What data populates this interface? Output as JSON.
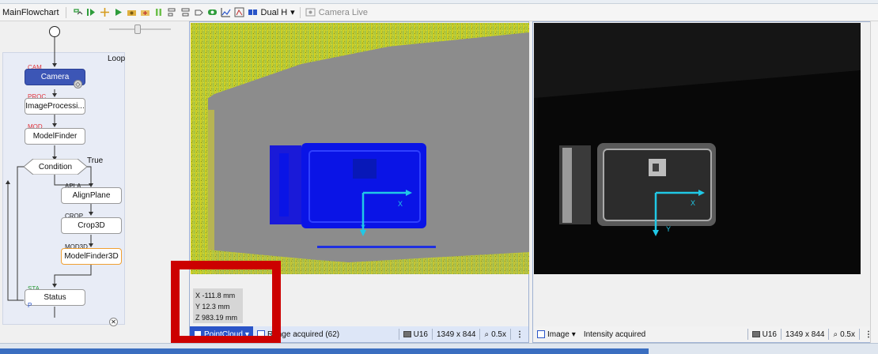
{
  "toolbar": {
    "title": "MainFlowchart",
    "dual_label": "Dual H",
    "camera_live_label": "Camera Live",
    "icons": [
      "step-icon",
      "run-icon",
      "play-icon",
      "camera-group-icon",
      "camera-add-icon",
      "pause-icon",
      "align-left-icon",
      "align-center-icon",
      "connect-icon",
      "record-icon",
      "chart-icon",
      "layout-icon",
      "grid-icon",
      "camera-live-icon"
    ]
  },
  "flowchart": {
    "loop_label": "Loop",
    "true_label": "True",
    "nodes": [
      {
        "tag": "CAM",
        "label": "Camera"
      },
      {
        "tag": "PROC",
        "label": "ImageProcessi..."
      },
      {
        "tag": "MOD",
        "label": "ModelFinder"
      },
      {
        "tag": "",
        "label": "Condition"
      },
      {
        "tag": "APLA",
        "label": "AlignPlane"
      },
      {
        "tag": "CROP",
        "label": "Crop3D"
      },
      {
        "tag": "MOD3D",
        "label": "ModelFinder3D"
      },
      {
        "tag": "STA",
        "label": "Status"
      }
    ],
    "status_port": "P"
  },
  "left_viewer": {
    "axis_x": "X",
    "axis_y": "Y",
    "coords": {
      "x": "X  -111.8 mm",
      "y": "Y  12.3 mm",
      "z": "Z  983.19 mm"
    },
    "status": {
      "mode_label": "PointCloud",
      "state_text": "Range acquired (62)",
      "format": "U16",
      "dims": "1349 x 844",
      "zoom": "0.5x",
      "more": "⋮"
    }
  },
  "right_viewer": {
    "axis_x": "X",
    "axis_y": "Y",
    "status": {
      "mode_label": "Image",
      "state_text": "Intensity acquired",
      "format": "U16",
      "dims": "1349 x 844",
      "zoom": "0.5x",
      "more": "⋮"
    }
  },
  "colors": {
    "selected_node": "#3c56b6",
    "highlight_frame": "#cc0000",
    "axis_cyan": "#20c8e6",
    "blue_object": "#0a14e6"
  }
}
